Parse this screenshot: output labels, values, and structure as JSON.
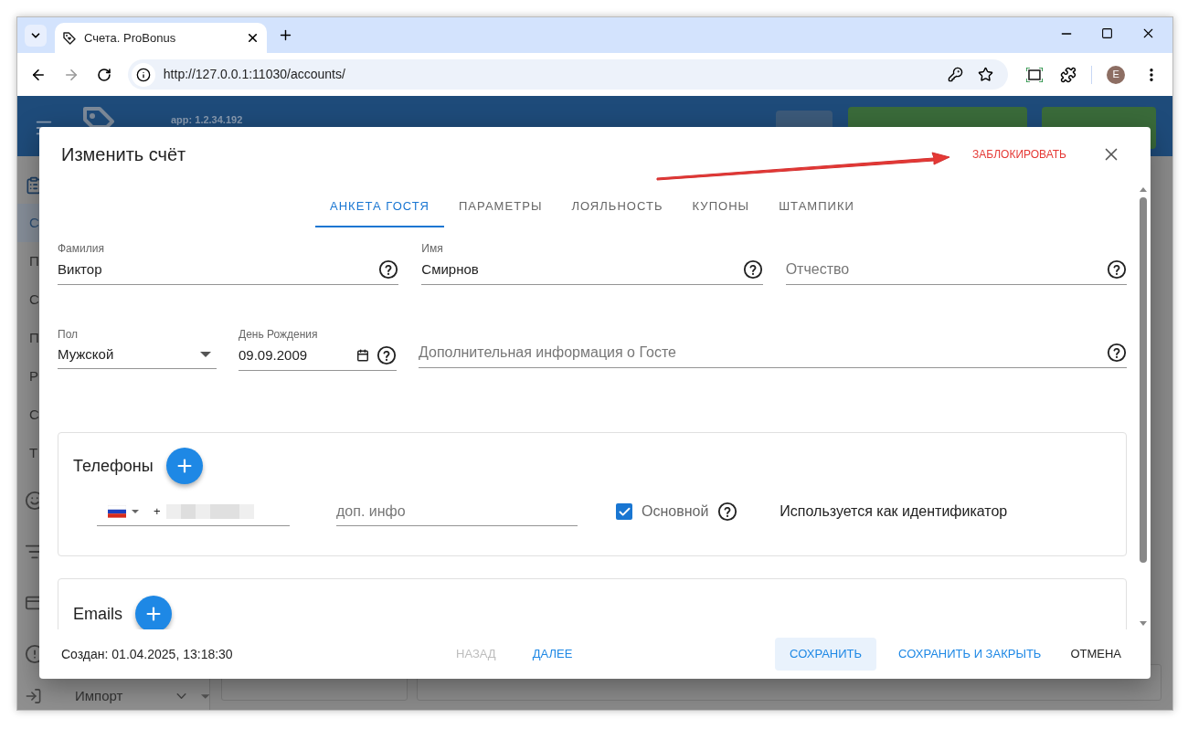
{
  "browser": {
    "tab_title": "Счета. ProBonus",
    "url": "http://127.0.0.1:11030/accounts/",
    "profile_initial": "E"
  },
  "app": {
    "version": "app: 1.2.34.192",
    "sidebar": [
      {
        "label": "С",
        "selected": true
      },
      {
        "label": "П",
        "selected": false
      },
      {
        "label": "С",
        "selected": false
      },
      {
        "label": "П",
        "selected": false
      },
      {
        "label": "Р",
        "selected": false
      },
      {
        "label": "С",
        "selected": false
      },
      {
        "label": "Т",
        "selected": false
      }
    ],
    "import_label": "Импорт"
  },
  "dialog": {
    "title": "Изменить счёт",
    "block_action": "ЗАБЛОКИРОВАТЬ",
    "tabs": [
      {
        "label": "АНКЕТА ГОСТЯ",
        "selected": true
      },
      {
        "label": "ПАРАМЕТРЫ",
        "selected": false
      },
      {
        "label": "ЛОЯЛЬНОСТЬ",
        "selected": false
      },
      {
        "label": "КУПОНЫ",
        "selected": false
      },
      {
        "label": "ШТАМПИКИ",
        "selected": false
      }
    ],
    "fields": [
      {
        "kind": "text",
        "label": "Фамилия",
        "value": "Виктор"
      },
      {
        "kind": "text",
        "label": "Имя",
        "value": "Смирнов"
      },
      {
        "kind": "text",
        "placeholder": "Отчество"
      },
      {
        "kind": "select",
        "label": "Пол",
        "value": "Мужской"
      },
      {
        "kind": "date",
        "label": "День Рождения",
        "value": "09.09.2009"
      },
      {
        "kind": "text",
        "placeholder": "Дополнительная информация о Госте"
      }
    ],
    "phones": {
      "title": "Телефоны",
      "number": "+",
      "extra_placeholder": "доп. инфо",
      "primary": {
        "label": "Основной",
        "checked": true
      },
      "note": "Используется как идентификатор"
    },
    "emails": {
      "title": "Emails"
    },
    "created": "Создан: 01.04.2025, 13:18:30",
    "buttons": [
      {
        "label": "НАЗАД",
        "kind": "disabled"
      },
      {
        "label": "ДАЛЕЕ",
        "kind": "text"
      },
      {
        "label": "СОХРАНИТЬ",
        "kind": "tonal"
      },
      {
        "label": "СОХРАНИТЬ И ЗАКРЫТЬ",
        "kind": "text"
      },
      {
        "label": "ОТМЕНА",
        "kind": "plain"
      }
    ]
  }
}
